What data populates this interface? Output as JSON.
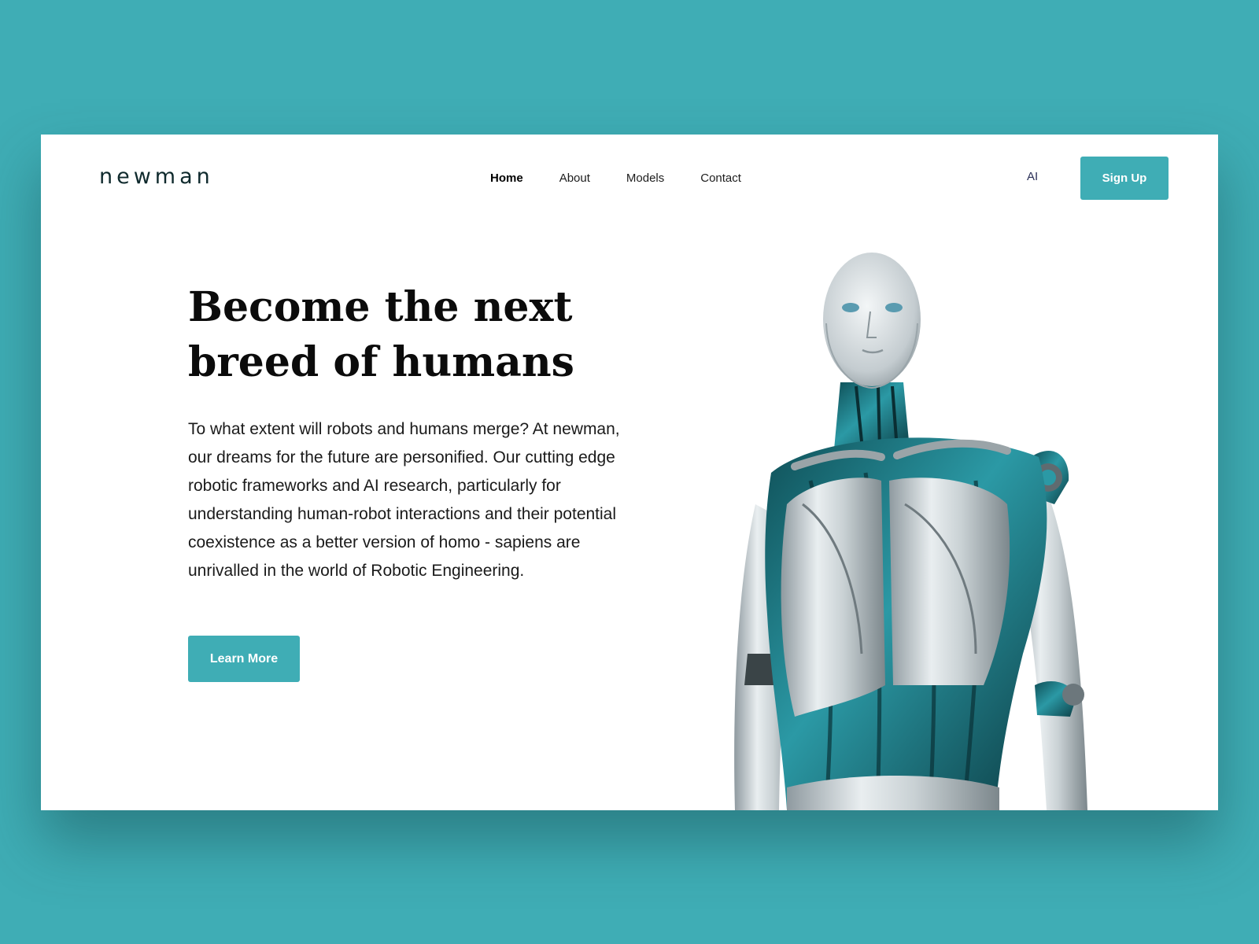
{
  "brand": {
    "logo_text": "newman"
  },
  "nav": {
    "items": [
      {
        "label": "Home",
        "active": true
      },
      {
        "label": "About",
        "active": false
      },
      {
        "label": "Models",
        "active": false
      },
      {
        "label": "Contact",
        "active": false
      }
    ],
    "language": "AI",
    "signup_label": "Sign Up"
  },
  "hero": {
    "title_line1": "Become the next",
    "title_line2": "breed of humans",
    "body": "To what extent will robots and humans merge? At newman, our dreams for the future are personified. Our cutting edge robotic frameworks and AI research, particularly for understanding human-robot interactions and their potential coexistence as a better version of homo - sapiens are unrivalled in the world of Robotic Engineering.",
    "cta_label": "Learn More"
  },
  "colors": {
    "accent": "#3fadb5",
    "background": "#3fadb5",
    "card": "#ffffff",
    "text": "#0b0b0b"
  },
  "image": {
    "icon": "humanoid-robot-illustration"
  }
}
